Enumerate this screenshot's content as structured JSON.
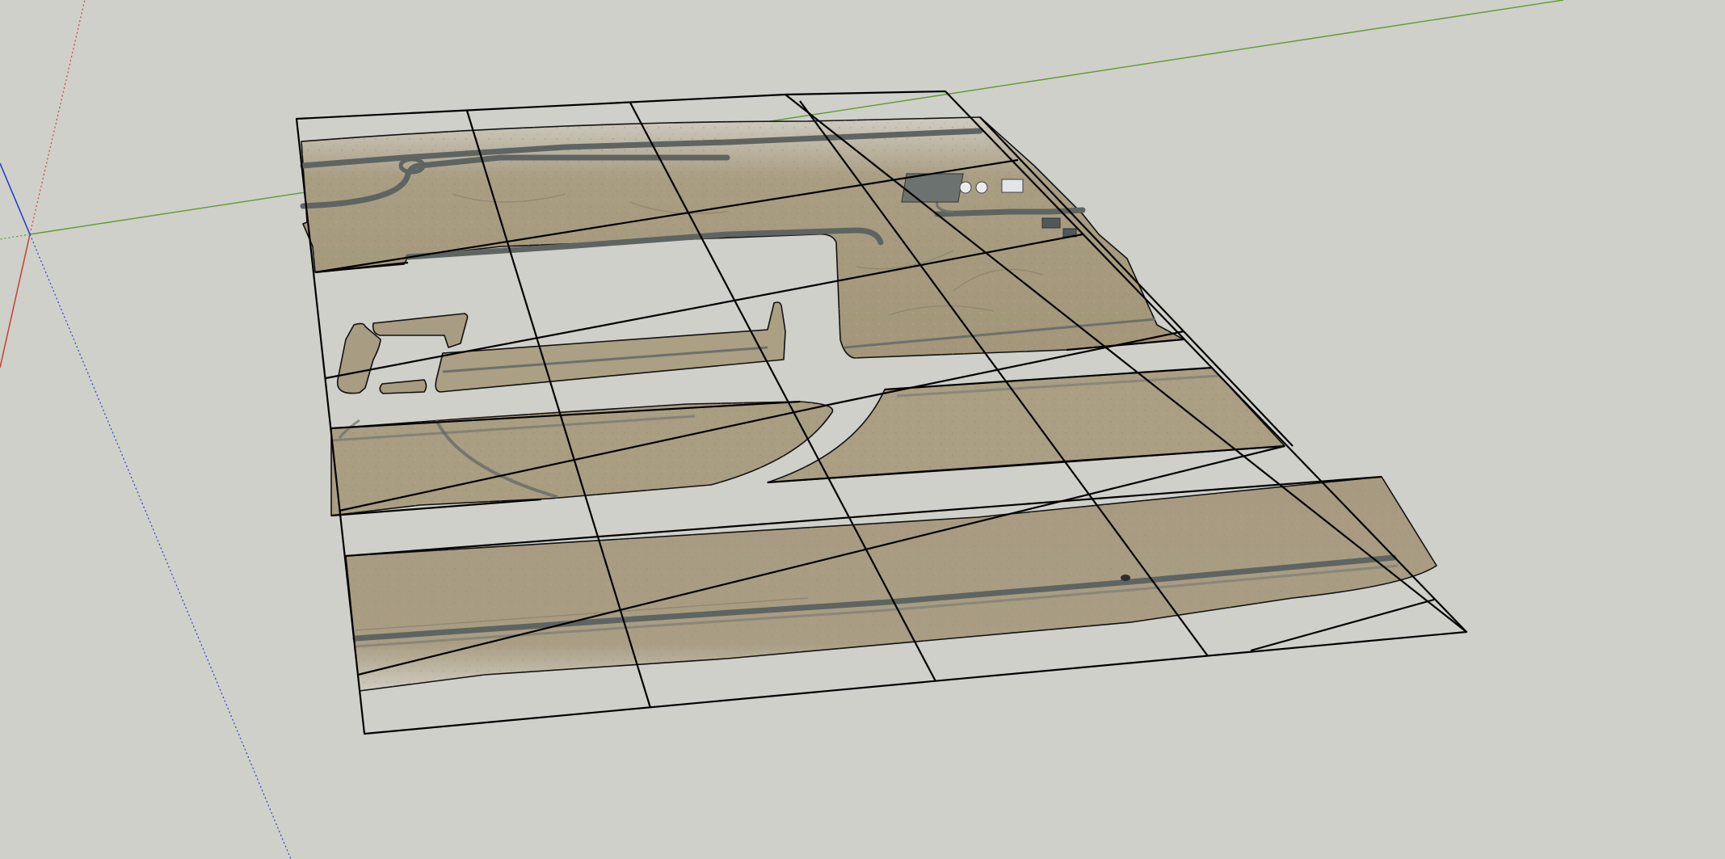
{
  "app": "SketchUp",
  "viewport": {
    "background": "#cfd0ca",
    "model": "aerial-imagery-terrain-grid",
    "axes": {
      "red": "#c7473a",
      "green": "#5f9a2e",
      "blue": "#2b3fc8"
    },
    "colors": {
      "terrain": "#a79a80",
      "terrain_light": "#b3a78d",
      "road": "#5e6462",
      "edges": "#000000"
    }
  }
}
